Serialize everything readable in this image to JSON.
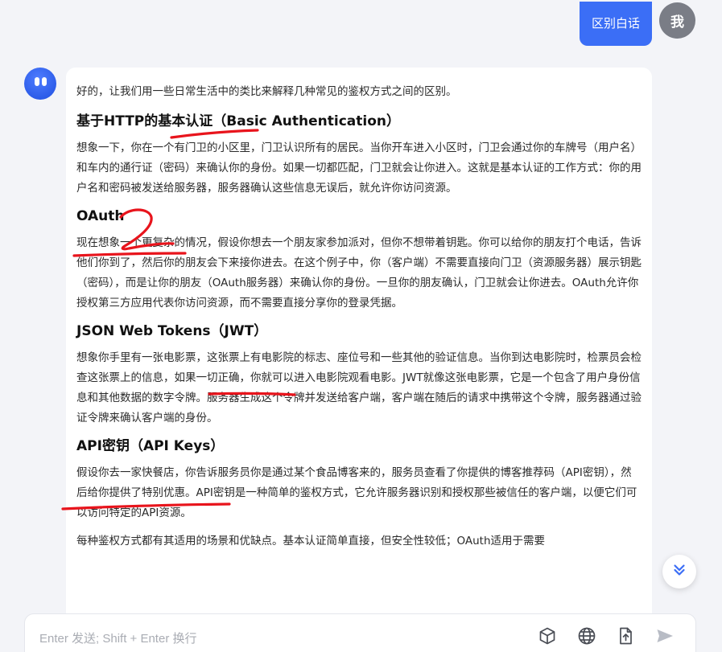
{
  "user": {
    "message": "区别白话",
    "avatar_label": "我"
  },
  "answer": {
    "intro": "好的，让我们用一些日常生活中的类比来解释几种常见的鉴权方式之间的区别。",
    "sections": [
      {
        "title": "基于HTTP的基本认证（Basic Authentication）",
        "body": "想象一下，你在一个有门卫的小区里，门卫认识所有的居民。当你开车进入小区时，门卫会通过你的车牌号（用户名）和车内的通行证（密码）来确认你的身份。如果一切都匹配，门卫就会让你进入。这就是基本认证的工作方式：你的用户名和密码被发送给服务器，服务器确认这些信息无误后，就允许你访问资源。"
      },
      {
        "title": "OAuth",
        "body": "现在想象一个更复杂的情况，假设你想去一个朋友家参加派对，但你不想带着钥匙。你可以给你的朋友打个电话，告诉他们你到了，然后你的朋友会下来接你进去。在这个例子中，你（客户端）不需要直接向门卫（资源服务器）展示钥匙（密码），而是让你的朋友（OAuth服务器）来确认你的身份。一旦你的朋友确认，门卫就会让你进去。OAuth允许你授权第三方应用代表你访问资源，而不需要直接分享你的登录凭据。"
      },
      {
        "title": "JSON Web Tokens（JWT）",
        "body": "想象你手里有一张电影票，这张票上有电影院的标志、座位号和一些其他的验证信息。当你到达电影院时，检票员会检查这张票上的信息，如果一切正确，你就可以进入电影院观看电影。JWT就像这张电影票，它是一个包含了用户身份信息和其他数据的数字令牌。服务器生成这个令牌并发送给客户端，客户端在随后的请求中携带这个令牌，服务器通过验证令牌来确认客户端的身份。"
      },
      {
        "title": "API密钥（API Keys）",
        "body": "假设你去一家快餐店，你告诉服务员你是通过某个食品博客来的，服务员查看了你提供的博客推荐码（API密钥），然后给你提供了特别优惠。API密钥是一种简单的鉴权方式，它允许服务器识别和授权那些被信任的客户端，以便它们可以访问特定的API资源。"
      }
    ],
    "summary": "每种鉴权方式都有其适用的场景和优缺点。基本认证简单直接，但安全性较低；OAuth适用于需要"
  },
  "input": {
    "placeholder": "Enter 发送; Shift + Enter 换行"
  },
  "icons": {
    "scroll": "chevron-double-down-icon",
    "tools": [
      "cube-icon",
      "globe-icon",
      "file-upload-icon",
      "send-icon"
    ]
  },
  "colors": {
    "accent": "#3b6ef6",
    "ink": "#e8141c",
    "background": "#f3f4f8"
  }
}
